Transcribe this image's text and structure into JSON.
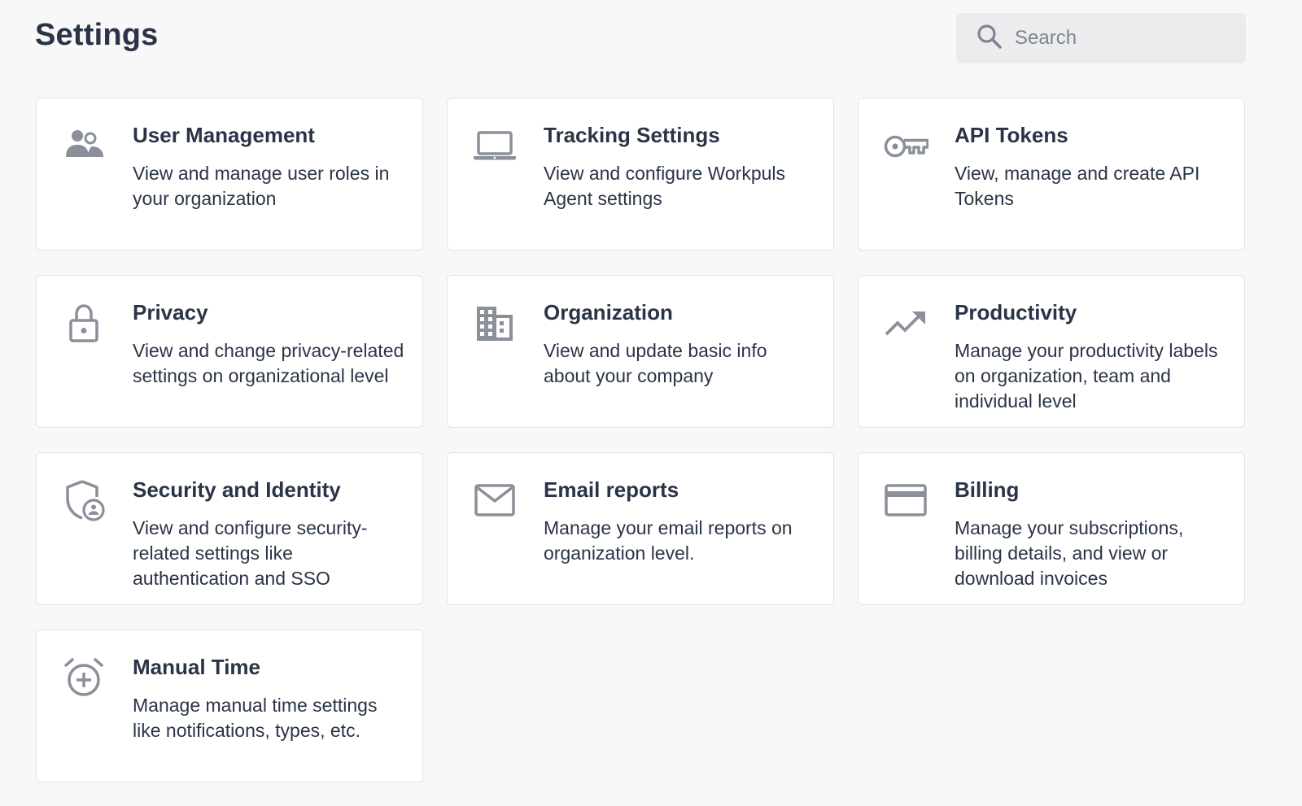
{
  "page": {
    "title": "Settings"
  },
  "search": {
    "placeholder": "Search",
    "icon": "search-icon"
  },
  "colors": {
    "background": "#f8f8f9",
    "card": "#ffffff",
    "text": "#2a3447",
    "icon": "#8a8f99",
    "search_bg": "#ececee"
  },
  "cards": [
    {
      "title": "User Management",
      "description": "View and manage user roles in your organization",
      "icon": "users-icon"
    },
    {
      "title": "Tracking Settings",
      "description": "View and configure Workpuls Agent settings",
      "icon": "laptop-icon"
    },
    {
      "title": "API Tokens",
      "description": "View, manage and create API Tokens",
      "icon": "key-icon"
    },
    {
      "title": "Privacy",
      "description": "View and change privacy-related settings on organizational level",
      "icon": "lock-icon"
    },
    {
      "title": "Organization",
      "description": "View and update basic info about your company",
      "icon": "building-icon"
    },
    {
      "title": "Productivity",
      "description": "Manage your productivity labels on organization, team and individual level",
      "icon": "trending-up-icon"
    },
    {
      "title": "Security and Identity",
      "description": "View and configure security-related settings like authentication and SSO",
      "icon": "shield-user-icon"
    },
    {
      "title": "Email reports",
      "description": "Manage your email reports on organization level.",
      "icon": "envelope-icon"
    },
    {
      "title": "Billing",
      "description": "Manage your subscriptions, billing details, and view or download invoices",
      "icon": "credit-card-icon"
    },
    {
      "title": "Manual Time",
      "description": "Manage manual time settings like notifications, types, etc.",
      "icon": "alarm-add-icon"
    }
  ]
}
